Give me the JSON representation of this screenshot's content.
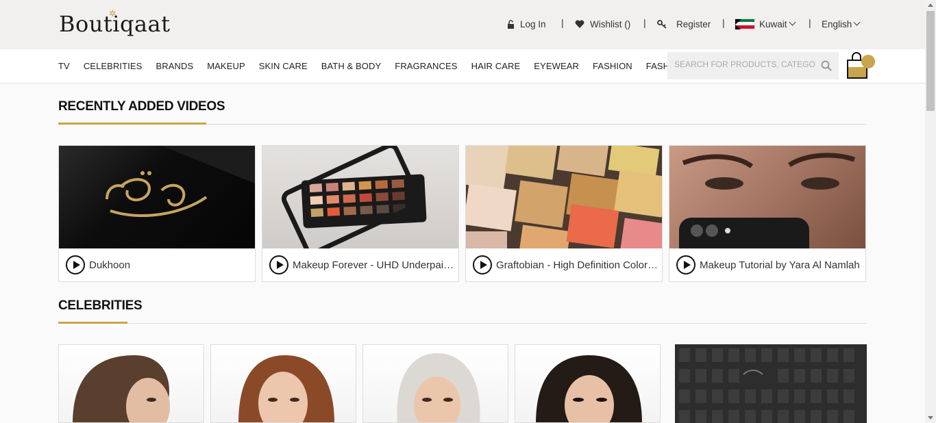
{
  "brand": {
    "logo_text": "Boutiqaat"
  },
  "header": {
    "login": "Log In",
    "wishlist": "Wishlist ()",
    "register": "Register",
    "country": "Kuwait",
    "language": "English",
    "separator": "|"
  },
  "nav": {
    "items": [
      "TV",
      "CELEBRITIES",
      "BRANDS",
      "MAKEUP",
      "SKIN CARE",
      "BATH & BODY",
      "FRAGRANCES",
      "HAIR CARE",
      "EYEWEAR",
      "FASHION",
      "FASHION TECH"
    ],
    "search_placeholder": "SEARCH FOR PRODUCTS, CATEGORIES"
  },
  "sections": {
    "videos_title": "RECENTLY ADDED VIDEOS",
    "celebrities_title": "CELEBRITIES"
  },
  "videos": [
    {
      "title": "Dukhoon"
    },
    {
      "title": "Makeup Forever - UHD Underpainting Palette"
    },
    {
      "title": "Graftobian - High Definition Color Palette"
    },
    {
      "title": "Makeup Tutorial by Yara Al Namlah"
    }
  ],
  "colors": {
    "accent": "#c9a44a",
    "topbar": "#f2f0ef"
  }
}
